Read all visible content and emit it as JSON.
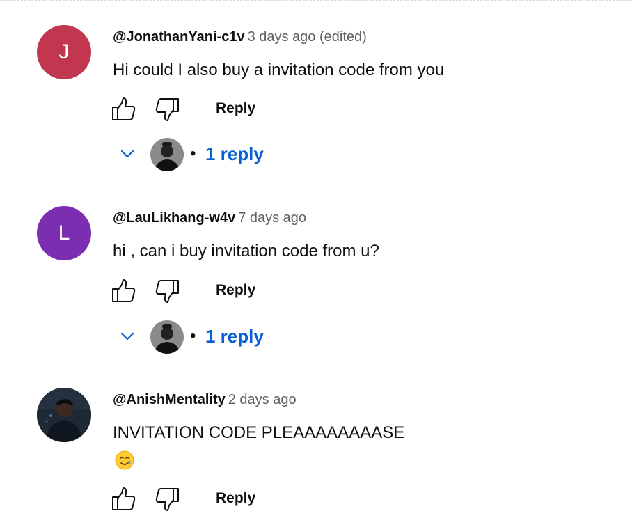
{
  "comments": [
    {
      "avatar_letter": "J",
      "avatar_color": "#c0374f",
      "handle": "@JonathanYani-c1v",
      "time": "3 days ago (edited)",
      "text": "Hi could I also buy a invitation code from you",
      "reply_label": "Reply",
      "replies_bullet": "•",
      "replies_count": "1 reply"
    },
    {
      "avatar_letter": "L",
      "avatar_color": "#7b2fb0",
      "handle": "@LauLikhang-w4v",
      "time": "7 days ago",
      "text": "hi , can i buy invitation code from u?",
      "reply_label": "Reply",
      "replies_bullet": "•",
      "replies_count": "1 reply"
    },
    {
      "avatar_letter": "",
      "avatar_color": "#1c2430",
      "handle": "@AnishMentality",
      "time": "2 days ago",
      "text": "INVITATION CODE PLEAAAAAAAASE",
      "emoji": "smiling-face-with-tear-icon",
      "reply_label": "Reply"
    }
  ],
  "colors": {
    "link_blue": "#065fd4",
    "muted_text": "#606060"
  }
}
